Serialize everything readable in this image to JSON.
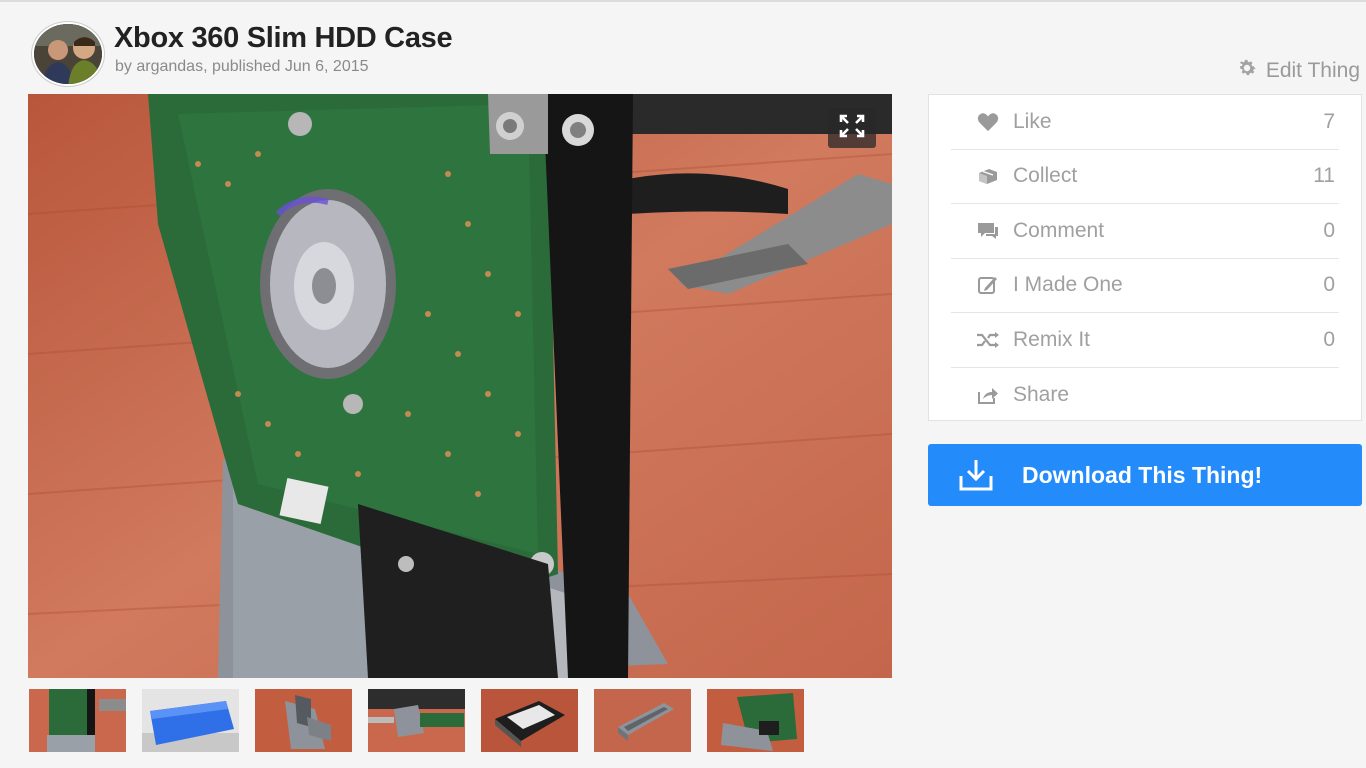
{
  "header": {
    "title": "Xbox 360 Slim HDD Case",
    "byline": "by argandas, published Jun 6, 2015",
    "edit_label": "Edit Thing"
  },
  "stats": [
    {
      "label": "Like",
      "count": "7",
      "icon": "heart-icon"
    },
    {
      "label": "Collect",
      "count": "11",
      "icon": "collect-icon"
    },
    {
      "label": "Comment",
      "count": "0",
      "icon": "comment-icon"
    },
    {
      "label": "I Made One",
      "count": "0",
      "icon": "made-one-icon"
    },
    {
      "label": "Remix It",
      "count": "0",
      "icon": "remix-icon"
    },
    {
      "label": "Share",
      "count": "",
      "icon": "share-icon"
    }
  ],
  "download": {
    "label": "Download This Thing!",
    "icon": "download-icon"
  },
  "colors": {
    "accent": "#248bfb",
    "muted_text": "#a0a0a0",
    "title_text": "#222222"
  }
}
